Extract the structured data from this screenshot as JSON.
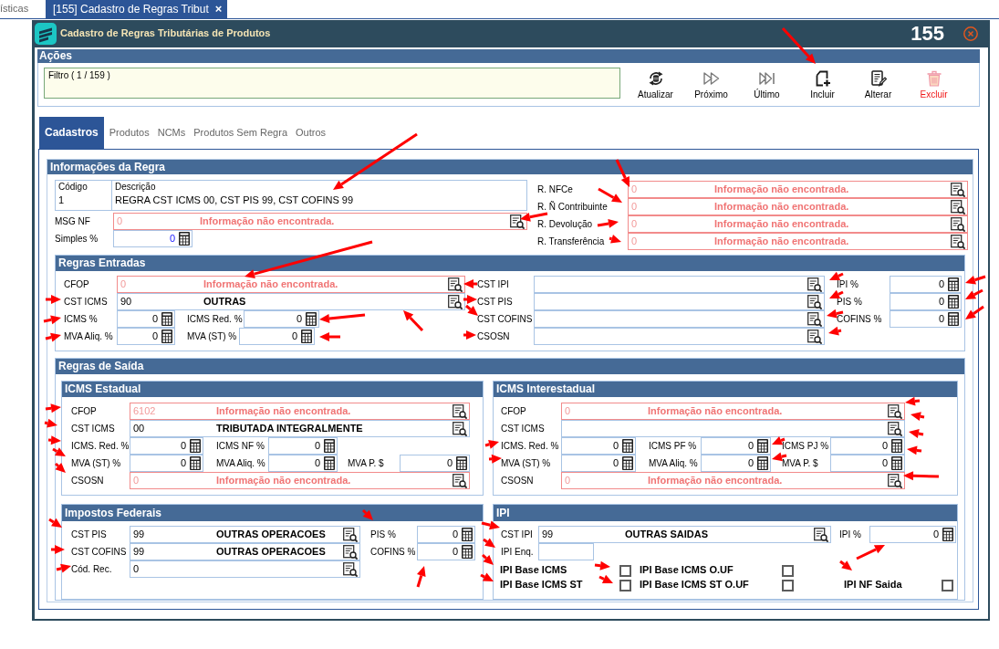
{
  "app_tabs": [
    {
      "label": "ísticas",
      "selected": false
    },
    {
      "label": "[155] Cadastro de Regras Tribut",
      "selected": true,
      "close": "×"
    }
  ],
  "window": {
    "title": "Cadastro de Regras Tributárias de Produtos",
    "record": "155"
  },
  "actions": {
    "title": "Ações",
    "filter": "Filtro ( 1 / 159 )",
    "buttons": [
      {
        "label": "Atualizar",
        "kind": "refresh"
      },
      {
        "label": "Próximo",
        "kind": "next"
      },
      {
        "label": "Último",
        "kind": "last"
      },
      {
        "label": "Incluir",
        "kind": "add"
      },
      {
        "label": "Alterar",
        "kind": "edit"
      },
      {
        "label": "Excluir",
        "kind": "delete"
      }
    ]
  },
  "tabs": [
    {
      "label": "Cadastros",
      "selected": true
    },
    {
      "label": "Produtos",
      "selected": false
    },
    {
      "label": "NCMs",
      "selected": false
    },
    {
      "label": "Produtos Sem Regra",
      "selected": false
    },
    {
      "label": "Outros",
      "selected": false
    }
  ],
  "rule_info": {
    "title": "Informações da Regra",
    "code": {
      "label": "Código",
      "value": "1"
    },
    "description": {
      "label": "Descrição",
      "value": "REGRA CST ICMS 00, CST PIS 99, CST COFINS 99"
    },
    "fields": [
      {
        "label": "MSG NF",
        "kind": "lookup",
        "code": "0",
        "description": "Informação não encontrada.",
        "not_found": true
      },
      {
        "label": "Simples %",
        "kind": "number",
        "value": "0",
        "focused": true
      }
    ],
    "references": [
      {
        "label": "R. NFCe",
        "kind": "lookup",
        "code": "0",
        "description": "Informação não encontrada.",
        "not_found": true
      },
      {
        "label": "R. Ñ Contribuinte",
        "kind": "lookup",
        "code": "0",
        "description": "Informação não encontrada.",
        "not_found": true
      },
      {
        "label": "R. Devolução",
        "kind": "lookup",
        "code": "0",
        "description": "Informação não encontrada.",
        "not_found": true
      },
      {
        "label": "R. Transferência",
        "kind": "lookup",
        "code": "0",
        "description": "Informação não encontrada.",
        "not_found": true
      }
    ]
  },
  "entry_rules": {
    "title": "Regras Entradas",
    "left": [
      {
        "label": "CFOP",
        "kind": "lookup",
        "code": "0",
        "description": "Informação não encontrada.",
        "not_found": true
      },
      {
        "label": "CST ICMS",
        "kind": "lookup",
        "code": "90",
        "description": "OUTRAS",
        "not_found": false
      },
      {
        "label": "ICMS %",
        "kind": "number",
        "value": "0"
      },
      {
        "label": "ICMS Red. %",
        "kind": "number",
        "value": "0"
      },
      {
        "label": "MVA Aliq. %",
        "kind": "number",
        "value": "0"
      },
      {
        "label": "MVA (ST) %",
        "kind": "number",
        "value": "0"
      }
    ],
    "middle": [
      {
        "label": "CST IPI",
        "kind": "lookup",
        "not_found": false
      },
      {
        "label": "CST PIS",
        "kind": "lookup",
        "not_found": false
      },
      {
        "label": "CST COFINS",
        "kind": "lookup",
        "not_found": false
      },
      {
        "label": "CSOSN",
        "kind": "lookup",
        "not_found": false
      }
    ],
    "right": [
      {
        "label": "IPI %",
        "kind": "number",
        "value": "0"
      },
      {
        "label": "PIS %",
        "kind": "number",
        "value": "0"
      },
      {
        "label": "COFINS %",
        "kind": "number",
        "value": "0"
      }
    ]
  },
  "exit_rules": {
    "title": "Regras de Saída",
    "state_icms": {
      "title": "ICMS Estadual",
      "fields": [
        {
          "label": "CFOP",
          "kind": "lookup",
          "code": "6102",
          "description": "Informação não encontrada.",
          "not_found": true
        },
        {
          "label": "CST ICMS",
          "kind": "lookup",
          "code": "00",
          "description": "TRIBUTADA INTEGRALMENTE",
          "not_found": false
        },
        {
          "label": "ICMS. Red. %",
          "kind": "number",
          "value": "0"
        },
        {
          "label": "ICMS NF %",
          "kind": "number",
          "value": "0"
        },
        {
          "label": "MVA (ST) %",
          "kind": "number",
          "value": "0"
        },
        {
          "label": "MVA Aliq. %",
          "kind": "number",
          "value": "0"
        },
        {
          "label": "MVA P. $",
          "kind": "number",
          "value": "0"
        },
        {
          "label": "CSOSN",
          "kind": "lookup",
          "code": "0",
          "description": "Informação não encontrada.",
          "not_found": true
        }
      ]
    },
    "interstate_icms": {
      "title": "ICMS Interestadual",
      "fields": [
        {
          "label": "CFOP",
          "kind": "lookup",
          "code": "0",
          "description": "Informação não encontrada.",
          "not_found": true
        },
        {
          "label": "CST ICMS",
          "kind": "lookup",
          "not_found": false
        },
        {
          "label": "ICMS. Red. %",
          "kind": "number",
          "value": "0"
        },
        {
          "label": "ICMS PF %",
          "kind": "number",
          "value": "0"
        },
        {
          "label": "ICMS PJ %",
          "kind": "number",
          "value": "0"
        },
        {
          "label": "MVA (ST) %",
          "kind": "number",
          "value": "0"
        },
        {
          "label": "MVA Aliq. %",
          "kind": "number",
          "value": "0"
        },
        {
          "label": "MVA P. $",
          "kind": "number",
          "value": "0"
        },
        {
          "label": "CSOSN",
          "kind": "lookup",
          "code": "0",
          "description": "Informação não encontrada.",
          "not_found": true
        }
      ]
    },
    "federal_taxes": {
      "title": "Impostos Federais",
      "fields": [
        {
          "label": "CST PIS",
          "kind": "lookup",
          "code": "99",
          "description": "OUTRAS OPERACOES",
          "not_found": false
        },
        {
          "label": "CST COFINS",
          "kind": "lookup",
          "code": "99",
          "description": "OUTRAS OPERACOES",
          "not_found": false
        },
        {
          "label": "Cód. Rec.",
          "kind": "lookup",
          "code": "0",
          "not_found": false
        },
        {
          "label": "PIS %",
          "kind": "number",
          "value": "0"
        },
        {
          "label": "COFINS %",
          "kind": "number",
          "value": "0"
        }
      ]
    },
    "ipi": {
      "title": "IPI",
      "fields": [
        {
          "label": "CST IPI",
          "kind": "lookup",
          "code": "99",
          "description": "OUTRAS SAIDAS",
          "not_found": false
        },
        {
          "label": "IPI %",
          "kind": "number",
          "value": "0"
        },
        {
          "label": "IPI Enq.",
          "kind": "text"
        }
      ],
      "checkbox_rows": [
        {
          "items": [
            {
              "label": "IPI Base ICMS",
              "checked": false
            },
            {
              "label": "IPI Base ICMS O.UF",
              "checked": false
            }
          ]
        },
        {
          "items": [
            {
              "label": "IPI Base ICMS ST",
              "checked": false
            },
            {
              "label": "IPI Base ICMS ST O.UF",
              "checked": false
            },
            {
              "label": "IPI NF Saida",
              "checked": false
            }
          ]
        }
      ]
    }
  }
}
